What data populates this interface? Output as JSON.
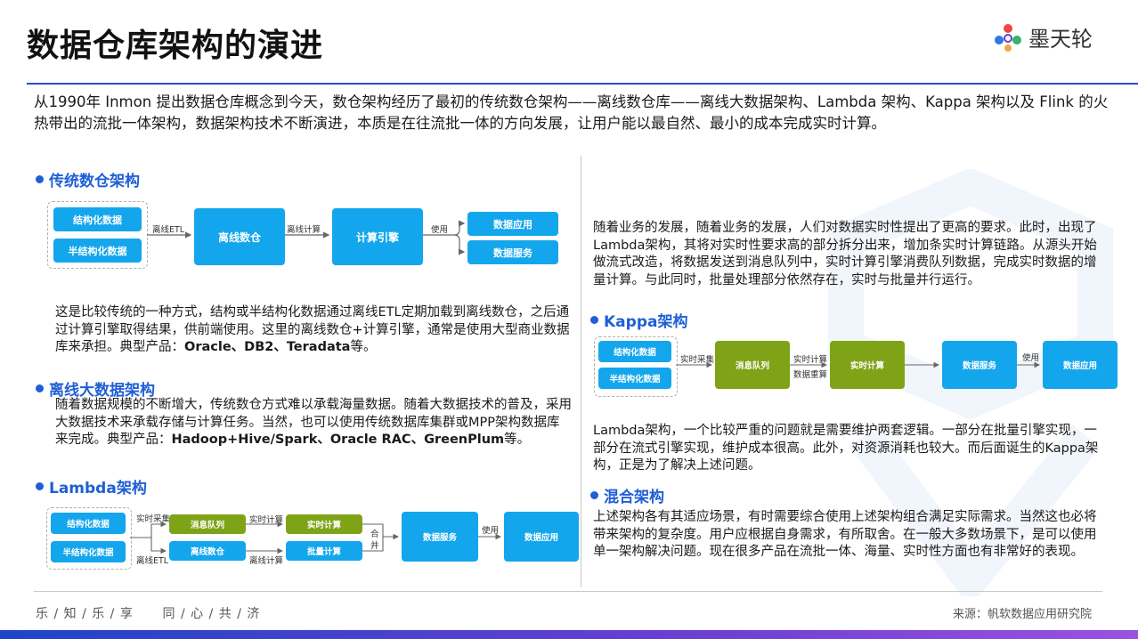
{
  "title": "数据仓库架构的演进",
  "logo": {
    "text": "墨天轮"
  },
  "intro": "从1990年 Inmon 提出数据仓库概念到今天，数仓架构经历了最初的传统数仓架构——离线数仓库——离线大数据架构、Lambda 架构、Kappa 架构以及 Flink 的火热带出的流批一体架构，数据架构技术不断演进，本质是在往流批一体的方向发展，让用户能以最自然、最小的成本完成实时计算。",
  "traditional": {
    "heading": "传统数仓架构",
    "sources": [
      "结构化数据",
      "半结构化数据"
    ],
    "edge1": "离线ETL",
    "warehouse": "离线数仓",
    "edge2": "离线计算",
    "engine": "计算引擎",
    "edge3": "使用",
    "outputs": [
      "数据应用",
      "数据服务"
    ],
    "desc_a": "这是比较传统的一种方式，结构或半结构化数据通过离线ETL定期加载到离线数仓，之后通过计算引擎取得结果，供前端使用。这里的离线数仓+计算引擎，通常是使用大型商业数据库来承担。典型产品：",
    "desc_products": "Oracle、DB2、Teradata",
    "desc_b": "等。"
  },
  "bigdata": {
    "heading": "离线大数据架构",
    "desc_a": "随着数据规模的不断增大，传统数仓方式难以承载海量数据。随着大数据技术的普及，采用大数据技术来承载存储与计算任务。当然，也可以使用传统数据库集群或MPP架构数据库来完成。典型产品：",
    "desc_products": "Hadoop+Hive/Spark、Oracle RAC、GreenPlum",
    "desc_b": "等。"
  },
  "lambda": {
    "heading": "Lambda架构",
    "sources": [
      "结构化数据",
      "半结构化数据"
    ],
    "edge_rt": "实时采集",
    "queue": "消息队列",
    "edge_rtc": "实时计算",
    "rt_compute": "实时计算",
    "edge_off": "离线ETL",
    "offline_wh": "离线数仓",
    "edge_offc": "离线计算",
    "batch_compute": "批量计算",
    "merge": [
      "合",
      "并"
    ],
    "service": "数据服务",
    "edge_use": "使用",
    "app": "数据应用",
    "desc": "随着业务的发展，随着业务的发展，人们对数据实时性提出了更高的要求。此时，出现了Lambda架构，其将对实时性要求高的部分拆分出来，增加条实时计算链路。从源头开始做流式改造，将数据发送到消息队列中，实时计算引擎消费队列数据，完成实时数据的增量计算。与此同时，批量处理部分依然存在，实时与批量并行运行。"
  },
  "kappa": {
    "heading": "Kappa架构",
    "sources": [
      "结构化数据",
      "半结构化数据"
    ],
    "edge_rt": "实时采集",
    "queue": "消息队列",
    "edge_rtc": "实时计算",
    "edge_replay": "数据重算",
    "rt_compute": "实时计算",
    "service": "数据服务",
    "edge_use": "使用",
    "app": "数据应用",
    "desc": "Lambda架构，一个比较严重的问题就是需要维护两套逻辑。一部分在批量引擎实现，一部分在流式引擎实现，维护成本很高。此外，对资源消耗也较大。而后面诞生的Kappa架构，正是为了解决上述问题。"
  },
  "hybrid": {
    "heading": "混合架构",
    "desc": "上述架构各有其适应场景，有时需要综合使用上述架构组合满足实际需求。当然这也必将带来架构的复杂度。用户应根据自身需求，有所取舍。在一般大多数场景下，是可以使用单一架构解决问题。现在很多产品在流批一体、海量、实时性方面也有非常好的表现。"
  },
  "footer": {
    "left": "乐 / 知 / 乐 / 享      同 / 心 / 共 / 济",
    "right": "来源：帆软数据应用研究院"
  },
  "colors": {
    "accent": "#1f5fd6",
    "box_blue": "#14a6ec",
    "box_green": "#7fa317"
  }
}
